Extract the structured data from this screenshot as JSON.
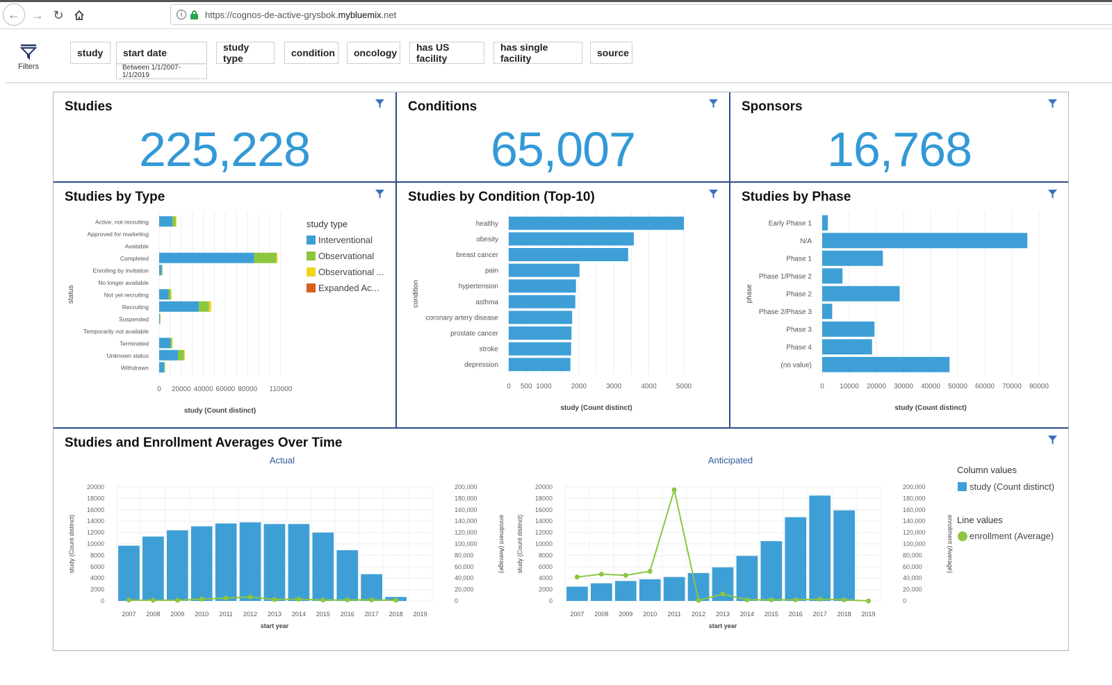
{
  "browser": {
    "url_prefix": "https://cognos-de-active-grysbok.",
    "url_host": "mybluemix",
    "url_suffix": ".net",
    "icons": [
      "back-arrow-icon",
      "forward-arrow-icon",
      "reload-icon",
      "home-icon",
      "info-icon",
      "lock-icon"
    ]
  },
  "filters": {
    "toggle_label": "Filters",
    "chips": [
      {
        "label": "study"
      },
      {
        "label": "start date",
        "sub": "Between 1/1/2007-1/1/2019"
      },
      {
        "label": "study type"
      },
      {
        "label": "condition"
      },
      {
        "label": "oncology"
      },
      {
        "label": "has US facility"
      },
      {
        "label": "has single facility"
      },
      {
        "label": "source"
      }
    ]
  },
  "colors": {
    "accent": "#3399d6",
    "bar": "#3e9fd6",
    "interventional": "#3e9fd6",
    "observational": "#8cc63f",
    "observational_patient_registry": "#f2d21b",
    "expanded_access": "#d9601c",
    "line": "#8cc63f",
    "panel_border": "#2b4a8a",
    "filter_icon": "#3a6fbf"
  },
  "kpis": [
    {
      "title": "Studies",
      "value": "225,228"
    },
    {
      "title": "Conditions",
      "value": "65,007"
    },
    {
      "title": "Sponsors",
      "value": "16,768"
    }
  ],
  "panels": {
    "by_type_title": "Studies by Type",
    "by_condition_title": "Studies by Condition (Top-10)",
    "by_phase_title": "Studies by Phase",
    "over_time_title": "Studies and Enrollment Averages Over Time"
  },
  "chart_data": [
    {
      "id": "studies_by_type",
      "type": "bar",
      "orientation": "horizontal",
      "stacked": true,
      "title": "Studies by Type",
      "ylabel": "status",
      "xlabel": "study (Count distinct)",
      "xticks": [
        0,
        20000,
        40000,
        60000,
        80000,
        110000
      ],
      "xlim": [
        0,
        110000
      ],
      "grid": true,
      "legend_title": "study type",
      "legend_position": "right",
      "categories": [
        "Active, not recruiting",
        "Approved for marketing",
        "Available",
        "Completed",
        "Enrolling by invitation",
        "No longer available",
        "Not yet recruiting",
        "Recruiting",
        "Suspended",
        "Temporarily not available",
        "Terminated",
        "Unknown status",
        "Withdrawn"
      ],
      "series": [
        {
          "name": "Interventional",
          "legend_label": "Interventional",
          "values": [
            12000,
            0,
            0,
            86000,
            2300,
            0,
            8500,
            36000,
            500,
            0,
            10500,
            17000,
            4500
          ]
        },
        {
          "name": "Observational",
          "legend_label": "Observational",
          "values": [
            3000,
            0,
            0,
            20000,
            300,
            0,
            2000,
            9000,
            100,
            0,
            1000,
            5500,
            800
          ]
        },
        {
          "name": "Observational [Patient Registry]",
          "legend_label": "Observational ...",
          "values": [
            200,
            0,
            0,
            1000,
            0,
            0,
            500,
            2000,
            0,
            0,
            100,
            200,
            0
          ]
        },
        {
          "name": "Expanded Access",
          "legend_label": "Expanded Ac...",
          "values": [
            0,
            0,
            0,
            0,
            0,
            0,
            0,
            0,
            0,
            0,
            0,
            0,
            0
          ]
        }
      ]
    },
    {
      "id": "studies_by_condition",
      "type": "bar",
      "orientation": "horizontal",
      "title": "Studies by Condition (Top-10)",
      "ylabel": "condition",
      "xlabel": "study (Count distinct)",
      "xticks": [
        0,
        500,
        1000,
        2000,
        3000,
        4000,
        5000
      ],
      "xlim": [
        0,
        5000
      ],
      "grid": true,
      "categories": [
        "healthy",
        "obesity",
        "breast cancer",
        "pain",
        "hypertension",
        "asthma",
        "coronary artery disease",
        "prostate cancer",
        "stroke",
        "depression"
      ],
      "values": [
        5000,
        3570,
        3410,
        2020,
        1920,
        1900,
        1810,
        1790,
        1780,
        1760
      ]
    },
    {
      "id": "studies_by_phase",
      "type": "bar",
      "orientation": "horizontal",
      "title": "Studies by Phase",
      "ylabel": "phase",
      "xlabel": "study (Count distinct)",
      "xticks": [
        0,
        10000,
        20000,
        30000,
        40000,
        50000,
        60000,
        70000,
        80000
      ],
      "xlim": [
        0,
        80000
      ],
      "grid": true,
      "categories": [
        "Early Phase 1",
        "N/A",
        "Phase 1",
        "Phase 1/Phase 2",
        "Phase 2",
        "Phase 2/Phase 3",
        "Phase 3",
        "Phase 4",
        "(no value)"
      ],
      "values": [
        2100,
        75700,
        22400,
        7500,
        28600,
        3700,
        19300,
        18400,
        47000
      ]
    },
    {
      "id": "actual_over_time",
      "type": "bar",
      "combo_line": true,
      "title": "Actual",
      "xlabel": "start year",
      "ylabel": "study (Count distinct)",
      "y2label": "enrollment (Average)",
      "categories": [
        "2007",
        "2008",
        "2009",
        "2010",
        "2011",
        "2012",
        "2013",
        "2014",
        "2015",
        "2016",
        "2017",
        "2018",
        "2019"
      ],
      "ylim": [
        0,
        20000
      ],
      "yticks": [
        0,
        2000,
        4000,
        6000,
        8000,
        10000,
        12000,
        14000,
        16000,
        18000,
        20000
      ],
      "y2lim": [
        0,
        200000
      ],
      "y2ticks": [
        "0",
        "20,000",
        "40,000",
        "60,000",
        "80,000",
        "100,000",
        "120,000",
        "140,000",
        "160,000",
        "180,000",
        "200,000"
      ],
      "grid": true,
      "series": [
        {
          "name": "study (Count distinct)",
          "kind": "bar",
          "values": [
            9700,
            11300,
            12400,
            13100,
            13600,
            13800,
            13500,
            13500,
            12000,
            8900,
            4700,
            700,
            null
          ]
        },
        {
          "name": "enrollment (Average)",
          "kind": "line",
          "values": [
            1500,
            1200,
            1200,
            3000,
            5000,
            7000,
            2500,
            3000,
            1500,
            1800,
            1800,
            1200,
            null
          ]
        }
      ]
    },
    {
      "id": "anticipated_over_time",
      "type": "bar",
      "combo_line": true,
      "title": "Anticipated",
      "xlabel": "start year",
      "ylabel": "study (Count distinct)",
      "y2label": "enrollment (Average)",
      "categories": [
        "2007",
        "2008",
        "2009",
        "2010",
        "2011",
        "2012",
        "2013",
        "2014",
        "2015",
        "2016",
        "2017",
        "2018",
        "2019"
      ],
      "ylim": [
        0,
        20000
      ],
      "yticks": [
        0,
        2000,
        4000,
        6000,
        8000,
        10000,
        12000,
        14000,
        16000,
        18000,
        20000
      ],
      "y2lim": [
        0,
        200000
      ],
      "y2ticks": [
        "0",
        "20,000",
        "40,000",
        "60,000",
        "80,000",
        "100,000",
        "120,000",
        "140,000",
        "160,000",
        "180,000",
        "200,000"
      ],
      "grid": true,
      "legend_position": "right",
      "legend": {
        "column_title": "Column values",
        "column_item": "study (Count distinct)",
        "line_title": "Line values",
        "line_item": "enrollment (Average)"
      },
      "series": [
        {
          "name": "study (Count distinct)",
          "kind": "bar",
          "values": [
            2500,
            3100,
            3500,
            3800,
            4200,
            4900,
            5900,
            7900,
            10500,
            14700,
            18500,
            15900,
            0
          ]
        },
        {
          "name": "enrollment (Average)",
          "kind": "line",
          "values": [
            42000,
            47000,
            45000,
            52000,
            195000,
            1000,
            12000,
            2000,
            2000,
            2000,
            3000,
            2000,
            0
          ]
        }
      ]
    }
  ]
}
